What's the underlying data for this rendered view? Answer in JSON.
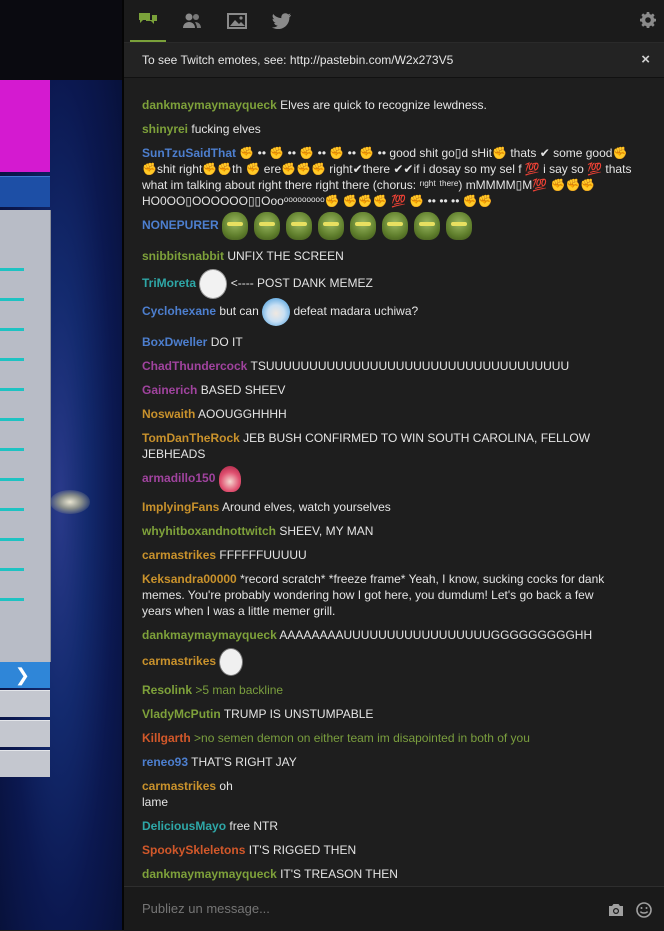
{
  "tabs": [
    {
      "name": "chat-tab",
      "icon": "chat-bubbles-icon"
    },
    {
      "name": "users-tab",
      "icon": "users-icon"
    },
    {
      "name": "gallery-tab",
      "icon": "image-icon"
    },
    {
      "name": "twitter-tab",
      "icon": "twitter-icon"
    }
  ],
  "notice": {
    "text": "To see Twitch emotes, see: http://pastebin.com/W2x273V5",
    "close": "×"
  },
  "colors": {
    "accent": "#7aa13a"
  },
  "messages": [
    {
      "user": "dankmaymaymayqueck",
      "color": "#7ea13a",
      "text": "Elves are quick to recognize lewdness."
    },
    {
      "user": "shinyrei",
      "color": "#7ea13a",
      "text": "fucking elves"
    },
    {
      "user": "SunTzuSaidThat",
      "color": "#4d7fcf",
      "text": "✊ •• ✊ •• ✊ •• ✊ •• ✊ •• good shit go▯d sHit✊ thats ✔ some good✊ ✊shit right✊✊th ✊ ere✊✊✊ right✔there ✔✔if i dosay so  my sel f  💯 i say so 💯 thats what im talking about right there right there (chorus: ʳᶦᵍʰᵗ ᵗʰᵉʳᵉ) mMMMM▯M💯 ✊✊✊ HO0OO▯OOOOOO▯▯Oooᵒᵒᵒᵒᵒᵒᵒᵒᵒ✊ ✊✊✊ 💯 ✊ •• •• •• ✊✊"
    },
    {
      "user": "NONEPURER",
      "color": "#4d7fcf",
      "text": ""
    },
    {
      "user": "snibbitsnabbit",
      "color": "#7ea13a",
      "text": "UNFIX THE SCREEN"
    },
    {
      "user": "TriMoreta",
      "color": "#2ea7a7",
      "text": "<---- POST DANK MEMEZ"
    },
    {
      "user": "Cyclohexane",
      "color": "#4d7fcf",
      "text": "but can",
      "text2": "defeat madara uchiwa?"
    },
    {
      "user": "BoxDweller",
      "color": "#4d7fcf",
      "text": "DO IT"
    },
    {
      "user": "ChadThundercock",
      "color": "#a0439e",
      "text": "TSUUUUUUUUUUUUUUUUUUUUUUUUUUUUUUUUUUU"
    },
    {
      "user": "Gainerich",
      "color": "#a0439e",
      "text": "BASED SHEEV"
    },
    {
      "user": "Noswaith",
      "color": "#c9922c",
      "text": "AOOUGGHHHH"
    },
    {
      "user": "TomDanTheRock",
      "color": "#c9922c",
      "text": "JEB BUSH CONFIRMED TO WIN SOUTH CAROLINA, FELLOW JEBHEADS"
    },
    {
      "user": "armadillo150",
      "color": "#a0439e",
      "text": ""
    },
    {
      "user": "ImplyingFans",
      "color": "#c9922c",
      "text": "Around elves, watch yourselves"
    },
    {
      "user": "whyhitboxandnottwitch",
      "color": "#7ea13a",
      "text": "SHEEV, MY MAN"
    },
    {
      "user": "carmastrikes",
      "color": "#c9922c",
      "text": "FFFFFFUUUUU"
    },
    {
      "user": "Keksandra00000",
      "color": "#c9922c",
      "text": "*record scratch* *freeze frame* Yeah, I know, sucking cocks for dank memes. You're probably wondering how I got here, you dumdum! Let's go back a few years when I was a little memer grill."
    },
    {
      "user": "dankmaymaymayqueck",
      "color": "#7ea13a",
      "text": "AAAAAAAAUUUUUUUUUUUUUUUUUGGGGGGGGGHH"
    },
    {
      "user": "carmastrikes",
      "color": "#c9922c",
      "text": ""
    },
    {
      "user": "Resolink",
      "color": "#7ea13a",
      "text": ">5 man backline",
      "greentext": true
    },
    {
      "user": "VladyMcPutin",
      "color": "#7ea13a",
      "text": "TRUMP IS UNSTUMPABLE"
    },
    {
      "user": "Killgarth",
      "color": "#d2582a",
      "text": ">no semen demon on either team im disapointed in both of you",
      "greentext": true
    },
    {
      "user": "reneo93",
      "color": "#4d7fcf",
      "text": "THAT'S RIGHT JAY"
    },
    {
      "user": "carmastrikes",
      "color": "#c9922c",
      "text": "oh",
      "text2": "lame"
    },
    {
      "user": "DeliciousMayo",
      "color": "#2ea7a7",
      "text": "free NTR"
    },
    {
      "user": "SpookySkleletons",
      "color": "#d2582a",
      "text": "IT'S RIGGED THEN"
    },
    {
      "user": "dankmaymaymayqueck",
      "color": "#7ea13a",
      "text": "IT'S TREASON THEN"
    }
  ],
  "input": {
    "placeholder": "Publiez un message..."
  }
}
